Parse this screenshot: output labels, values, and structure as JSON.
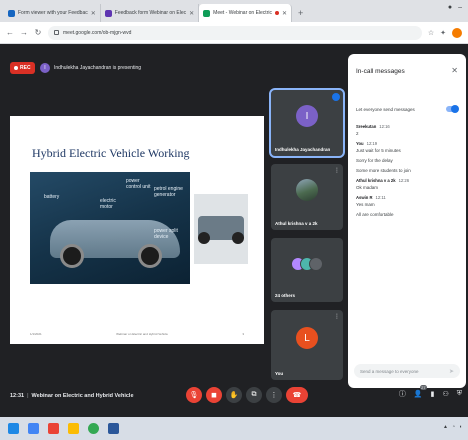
{
  "browser": {
    "tabs": [
      {
        "label": "Form viewer with your Feedbac",
        "active": false
      },
      {
        "label": "Feedback form Webinar on Elec",
        "active": false
      },
      {
        "label": "Meet - Webinar on Electric",
        "active": true
      }
    ],
    "url": "meet.google.com/ob-mjgn-wvd"
  },
  "meet": {
    "recording_label": "REC",
    "presenter": {
      "initial": "I",
      "text": "Indhulekha Jayachandran is presenting"
    },
    "slide": {
      "title": "Hybrid Electric Vehicle Working",
      "labels": {
        "battery": "battery",
        "electric_motor": "electric motor",
        "power_control_unit": "power control unit",
        "petrol_engine_generator": "petrol engine generator",
        "power_split_device": "power split device"
      },
      "footer_left": "1/1/2021",
      "footer_center": "Webinar on Electric and Hybrid Vehicle",
      "footer_right": "3"
    },
    "tiles": [
      {
        "kind": "letter",
        "initial": "I",
        "color": "#7b61c7",
        "name": "Indhulekha Jayachandran",
        "speaking": true
      },
      {
        "kind": "photo",
        "name": "Athul krishna v a 2k",
        "speaking": false
      },
      {
        "kind": "multi",
        "name": "24 others",
        "colors": [
          "#b388ff",
          "#4db6ac",
          "#5f6368"
        ],
        "speaking": false
      },
      {
        "kind": "letter",
        "initial": "L",
        "color": "#e8501f",
        "name": "You",
        "speaking": false
      }
    ],
    "chat": {
      "title": "In-call messages",
      "toggle_label": "Let everyone send messages",
      "toggle_on": true,
      "messages": [
        {
          "sender": "Sreekutan",
          "time": "12:16",
          "lines": [
            "2"
          ]
        },
        {
          "sender": "You",
          "time": "12:19",
          "lines": [
            "Just wait for 5 minutes",
            "Sorry for the delay",
            "Some more students to join"
          ]
        },
        {
          "sender": "Athul krishna v a 2k",
          "time": "12:26",
          "lines": [
            "Ok madam"
          ]
        },
        {
          "sender": "Aswin R",
          "time": "12:11",
          "lines": [
            "Yes mam",
            "All are comfortable"
          ]
        }
      ],
      "input_placeholder": "Send a message to everyone"
    },
    "bottom": {
      "time": "12:31",
      "meeting_name": "Webinar on Electric and Hybrid Vehicle",
      "participant_count": "27"
    }
  }
}
